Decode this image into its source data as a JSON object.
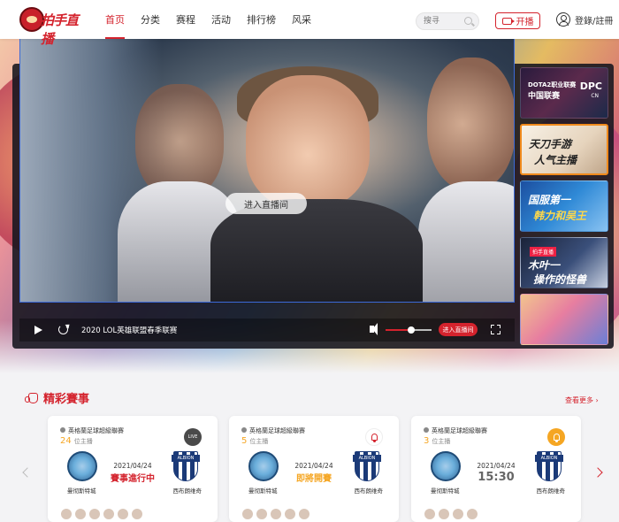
{
  "header": {
    "logo_text": "拍手直播",
    "nav": [
      "首页",
      "分类",
      "赛程",
      "活动",
      "排行榜",
      "风采"
    ],
    "search_placeholder": "搜寻",
    "broadcast_label": "开播",
    "user_label": "登錄/註冊"
  },
  "player": {
    "enter_label": "进入直播间",
    "title": "2020 LOL英雄联盟春季联赛",
    "enter_small_label": "进入直播间",
    "volume": 0.55
  },
  "thumbnails": [
    {
      "line1": "DOTA2职业联赛",
      "line2": "中国联赛",
      "logo": "DPC",
      "logo_sub": "CN"
    },
    {
      "big1": "天刀手游",
      "big2": "人气主播"
    },
    {
      "big1": "国服第一",
      "big2": "韩力和吴王"
    },
    {
      "chip": "拍手直播",
      "big1": "木叶一",
      "big2": "操作的怪兽"
    },
    {
      "tag": ""
    }
  ],
  "section": {
    "title": "精彩賽事",
    "more": "查看更多 ›"
  },
  "matches": [
    {
      "league": "英格蘭足球超級聯賽",
      "hosts": "24",
      "hosts_suffix": "位主播",
      "badge": "LIVE",
      "date": "2021/04/24",
      "status": "賽事進行中",
      "home": "曼彻斯特城",
      "away": "西布朗维奇",
      "away_short": "ALBION"
    },
    {
      "league": "英格蘭足球超級聯賽",
      "hosts": "5",
      "hosts_suffix": "位主播",
      "badge": "bell",
      "date": "2021/04/24",
      "status": "即將開賽",
      "home": "曼彻斯特城",
      "away": "西布朗维奇",
      "away_short": "ALBION"
    },
    {
      "league": "英格蘭足球超級聯賽",
      "hosts": "3",
      "hosts_suffix": "位主播",
      "badge": "bell",
      "date": "2021/04/24",
      "status": "15:30",
      "home": "曼彻斯特城",
      "away": "西布朗维奇",
      "away_short": "ALBION"
    }
  ],
  "colors": {
    "accent": "#d4232d",
    "orange": "#f5a623"
  }
}
